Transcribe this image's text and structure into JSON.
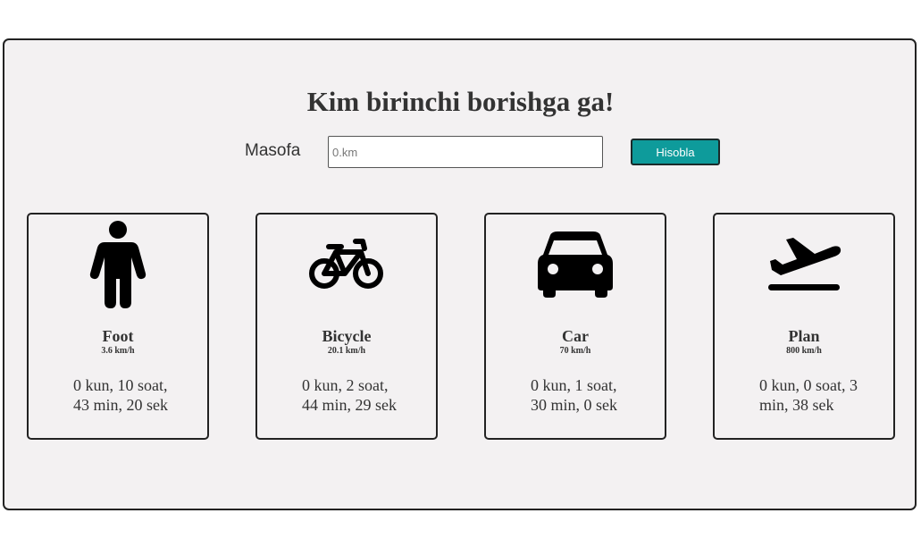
{
  "header": {
    "title": "Kim birinchi borishga ga!"
  },
  "form": {
    "distance_label": "Masofa",
    "distance_placeholder": "0.km",
    "calculate_label": "Hisobla"
  },
  "cards": [
    {
      "icon": "person-icon",
      "name": "Foot",
      "speed": "3.6 km/h",
      "result": "0 kun, 10 soat, 43 min, 20 sek"
    },
    {
      "icon": "bicycle-icon",
      "name": "Bicycle",
      "speed": "20.1 km/h",
      "result": "0 kun, 2 soat, 44 min, 29 sek"
    },
    {
      "icon": "car-icon",
      "name": "Car",
      "speed": "70 km/h",
      "result": "0 kun, 1 soat, 30 min, 0 sek"
    },
    {
      "icon": "airplane-icon",
      "name": "Plan",
      "speed": "800 km/h",
      "result": "0 kun, 0 soat, 3 min, 38 sek"
    }
  ],
  "colors": {
    "button": "#0e9b9b",
    "panel": "#f3f1f2",
    "border": "#222222"
  }
}
